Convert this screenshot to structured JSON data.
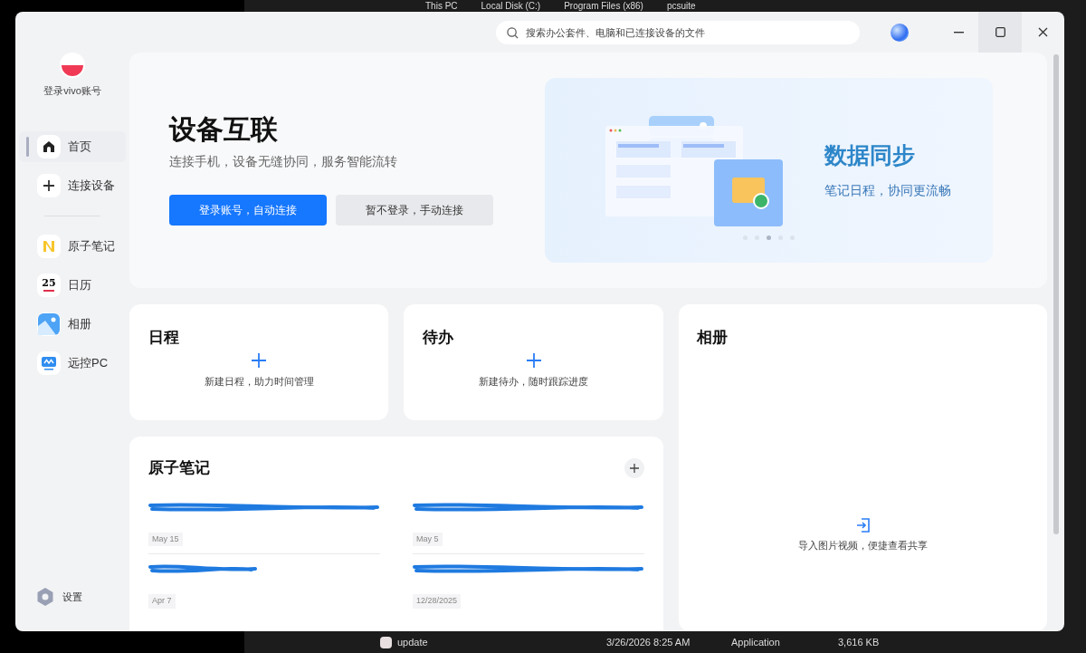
{
  "explorer": {
    "breadcrumb": [
      "This PC",
      "Local Disk (C:)",
      "Program Files (x86)",
      "pcsuite"
    ],
    "file_row": {
      "name": "update",
      "modified": "3/26/2026 8:25 AM",
      "type": "Application",
      "size": "3,616 KB"
    }
  },
  "window": {
    "search": {
      "placeholder": "搜索办公套件、电脑和已连接设备的文件"
    }
  },
  "sidebar": {
    "account": "登录vivo账号",
    "nav": [
      {
        "label": "首页",
        "kind": "home",
        "selected": true
      },
      {
        "label": "连接设备",
        "kind": "plus",
        "selected": false
      }
    ],
    "apps": [
      {
        "label": "原子笔记",
        "kind": "notes",
        "selected": false
      },
      {
        "label": "日历",
        "kind": "calendar",
        "badge": "25",
        "selected": false
      },
      {
        "label": "相册",
        "kind": "gallery",
        "selected": false
      },
      {
        "label": "远控PC",
        "kind": "remote",
        "selected": false
      }
    ],
    "settings": "设置"
  },
  "hero": {
    "title": "设备互联",
    "subtitle": "连接手机，设备无缝协同，服务智能流转",
    "buttons": [
      {
        "label": "登录账号，自动连接",
        "kind": "primary"
      },
      {
        "label": "暂不登录，手动连接",
        "kind": "secondary"
      }
    ],
    "banner": {
      "title": "数据同步",
      "subtitle": "笔记日程，协同更流畅",
      "dots": [
        {
          "selected": false
        },
        {
          "selected": false
        },
        {
          "selected": true
        },
        {
          "selected": false
        },
        {
          "selected": false
        }
      ]
    }
  },
  "schedule": {
    "title": "日程",
    "hint": "新建日程，助力时间管理"
  },
  "todo": {
    "title": "待办",
    "hint": "新建待办，随时跟踪进度"
  },
  "album": {
    "title": "相册",
    "hint": "导入图片视频，便捷查看共享"
  },
  "notes": {
    "title": "原子笔记",
    "items": [
      {
        "date": "May 15"
      },
      {
        "date": "May 5"
      },
      {
        "date": "Apr 7"
      },
      {
        "date": "12/28/2025"
      }
    ]
  }
}
